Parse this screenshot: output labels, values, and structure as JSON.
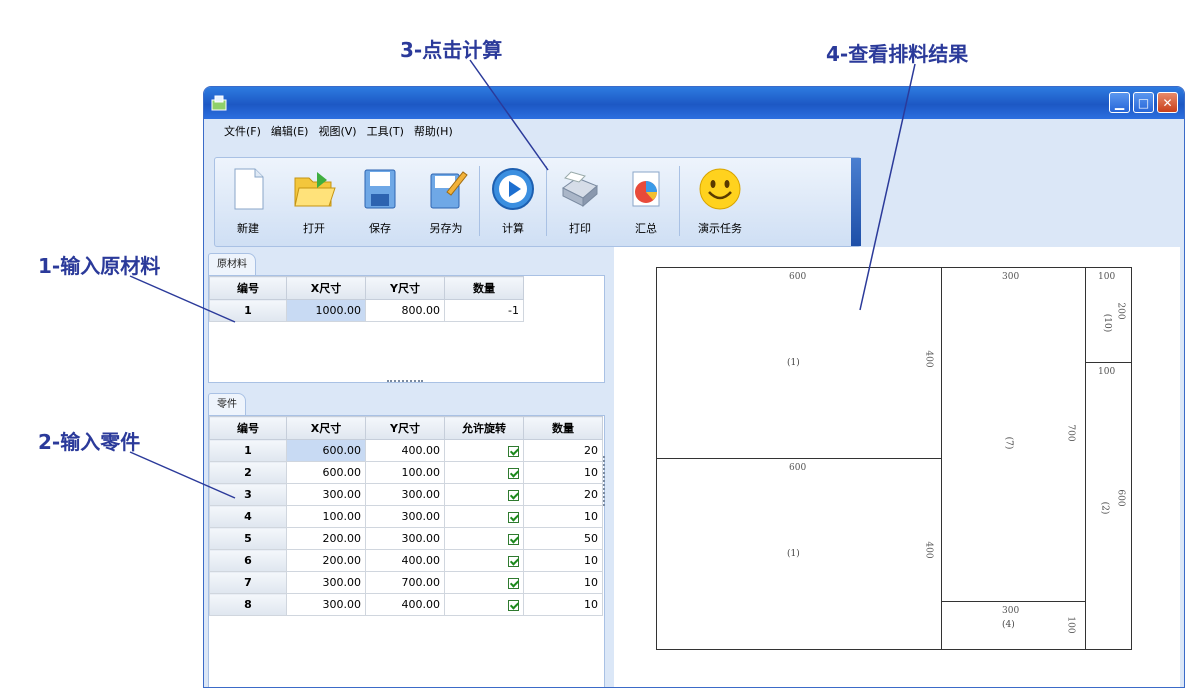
{
  "annotations": {
    "a1": "1-输入原材料",
    "a2": "2-输入零件",
    "a3": "3-点击计算",
    "a4": "4-查看排料结果"
  },
  "menu": [
    "文件(F)",
    "编辑(E)",
    "视图(V)",
    "工具(T)",
    "帮助(H)"
  ],
  "toolbar": {
    "new": "新建",
    "open": "打开",
    "save": "保存",
    "saveas": "另存为",
    "calc": "计算",
    "print": "打印",
    "summary": "汇总",
    "demo": "演示任务"
  },
  "materials": {
    "tab": "原材料",
    "headers": [
      "编号",
      "X尺寸",
      "Y尺寸",
      "数量"
    ],
    "rows": [
      [
        "1",
        "1000.00",
        "800.00",
        "-1"
      ]
    ]
  },
  "parts": {
    "tab": "零件",
    "headers": [
      "编号",
      "X尺寸",
      "Y尺寸",
      "允许旋转",
      "数量"
    ],
    "rows": [
      [
        "1",
        "600.00",
        "400.00",
        "20"
      ],
      [
        "2",
        "600.00",
        "100.00",
        "10"
      ],
      [
        "3",
        "300.00",
        "300.00",
        "20"
      ],
      [
        "4",
        "100.00",
        "300.00",
        "10"
      ],
      [
        "5",
        "200.00",
        "300.00",
        "50"
      ],
      [
        "6",
        "200.00",
        "400.00",
        "10"
      ],
      [
        "7",
        "300.00",
        "700.00",
        "10"
      ],
      [
        "8",
        "300.00",
        "400.00",
        "10"
      ]
    ]
  },
  "layout": {
    "pieces": [
      {
        "w": "600",
        "h": "400",
        "id": "(1)"
      },
      {
        "w": "600",
        "h": "400",
        "id": "(1)"
      },
      {
        "h": "700",
        "id": "(7)",
        "w": "300"
      },
      {
        "w": "300",
        "id": "(4)",
        "h": "100"
      },
      {
        "w": "100",
        "h": "200",
        "id": "(10)"
      },
      {
        "w": "100",
        "h": "600",
        "id": "(2)"
      }
    ]
  },
  "colors": {
    "accent": "#2b3a9a",
    "titlebar": "#1d58c4"
  }
}
